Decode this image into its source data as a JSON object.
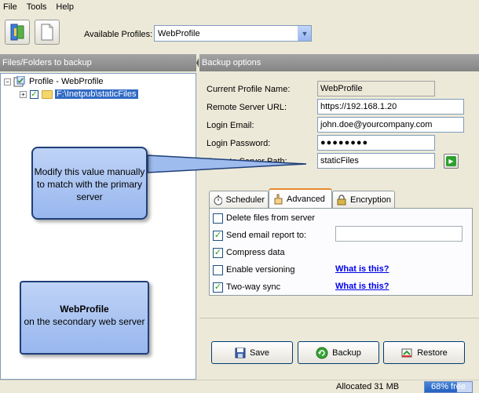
{
  "menubar": {
    "items": [
      "File",
      "Tools",
      "Help"
    ]
  },
  "toolbar": {
    "available_profiles_label": "Available Profiles:",
    "selected_profile": "WebProfile"
  },
  "left_panel": {
    "header": "Files/Folders to backup",
    "tree": {
      "root_label": "Profile - WebProfile",
      "child_label": "F:\\Inetpub\\staticFiles"
    }
  },
  "right_panel": {
    "header": "Backup options",
    "fields": {
      "profile_name_label": "Current Profile Name:",
      "profile_name_value": "WebProfile",
      "server_url_label": "Remote Server URL:",
      "server_url_value": "https://192.168.1.20",
      "login_email_label": "Login Email:",
      "login_email_value": "john.doe@yourcompany.com",
      "login_password_label": "Login Password:",
      "login_password_value": "●●●●●●●●",
      "server_path_label": "Remote Server Path:",
      "server_path_value": "staticFiles"
    },
    "tabs": [
      "Scheduler",
      "Advanced",
      "Encryption"
    ],
    "active_tab": "Advanced",
    "advanced_options": [
      {
        "label": "Delete files from server",
        "checked": false
      },
      {
        "label": "Send email report to:",
        "checked": true
      },
      {
        "label": "Compress data",
        "checked": true
      },
      {
        "label": "Enable versioning",
        "checked": false,
        "help": "What is this?"
      },
      {
        "label": "Two-way sync",
        "checked": true,
        "help": "What is this?"
      }
    ],
    "buttons": {
      "save": "Save",
      "backup": "Backup",
      "restore": "Restore"
    }
  },
  "callouts": {
    "modify_path": "Modify this value manually to match with the primary server",
    "profile_title": "WebProfile",
    "profile_desc": "on the secondary web server"
  },
  "status": {
    "allocated": "Allocated 31 MB",
    "free_label": "68% free",
    "free_fraction": 0.68
  },
  "colors": {
    "selection": "#316ac5",
    "link": "#0000ee",
    "callout": "#9fbcef",
    "active_tab_accent": "#e68b2c"
  }
}
